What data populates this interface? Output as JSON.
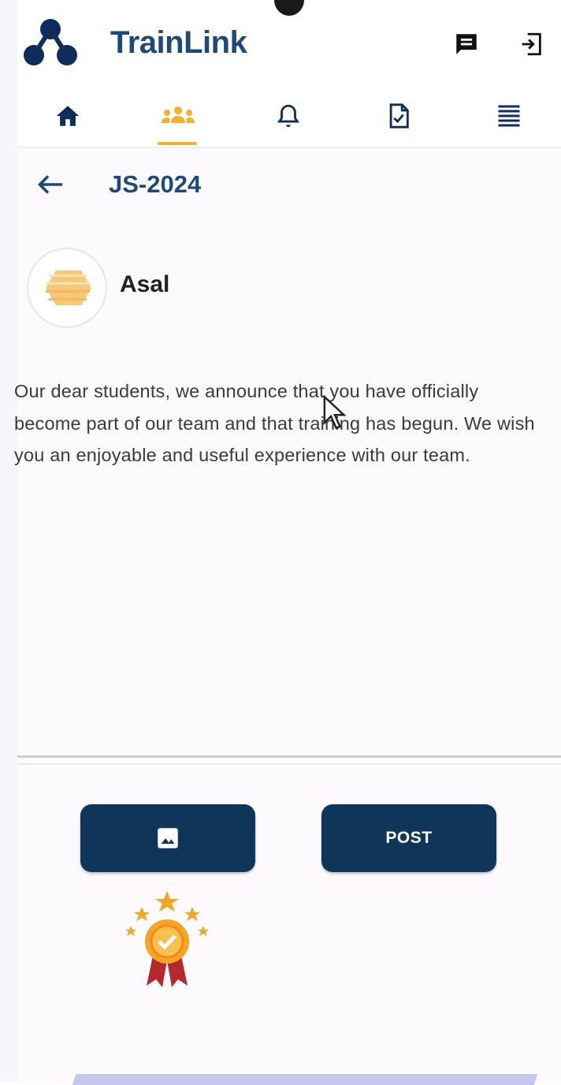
{
  "app": {
    "title": "TrainLink",
    "accent_color": "#1e4a7a",
    "highlight_color": "#f3b12e",
    "button_color": "#0f3558"
  },
  "header": {
    "icons": [
      "logo-icon",
      "chat-icon",
      "logout-icon"
    ]
  },
  "nav": {
    "items": [
      {
        "icon": "home-icon",
        "active": false
      },
      {
        "icon": "group-icon",
        "active": true
      },
      {
        "icon": "bell-icon",
        "active": false
      },
      {
        "icon": "document-check-icon",
        "active": false
      },
      {
        "icon": "list-icon",
        "active": false
      }
    ]
  },
  "page": {
    "title": "JS-2024"
  },
  "post": {
    "author": "Asal",
    "text": "Our dear students, we announce that you have officially become part of our team and that training has begun. We wish you an enjoyable and useful experience with our team."
  },
  "actions": {
    "image_button_icon": "image-icon",
    "post_label": "POST"
  },
  "badge": {
    "icon": "award-badge-icon"
  }
}
